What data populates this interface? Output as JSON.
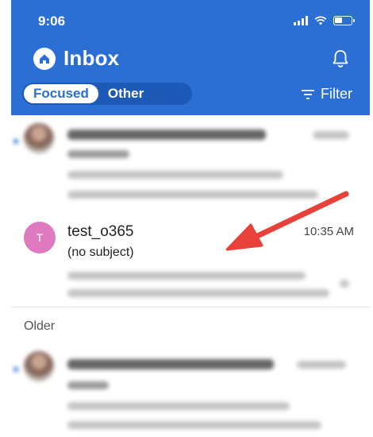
{
  "status_bar": {
    "time": "9:06"
  },
  "header": {
    "title": "Inbox",
    "tabs": {
      "focused": "Focused",
      "other": "Other"
    },
    "filter_label": "Filter"
  },
  "message": {
    "avatar_letter": "T",
    "sender": "test_o365",
    "subject": "(no subject)",
    "time": "10:35 AM"
  },
  "section": {
    "older_label": "Older"
  },
  "colors": {
    "header_blue": "#2b6fd4",
    "avatar_pink": "#e07ac0",
    "annotation_arrow": "#e8413a"
  }
}
